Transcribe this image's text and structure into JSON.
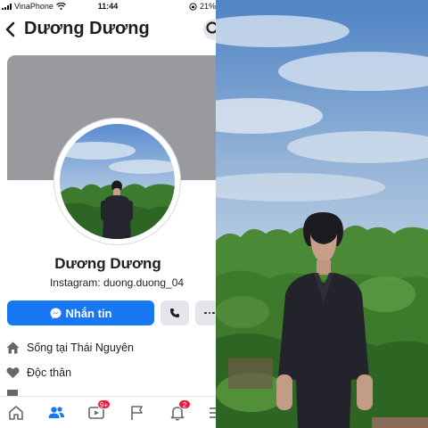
{
  "status_bar": {
    "carrier": "VinaPhone",
    "time": "11:44",
    "battery": "21%"
  },
  "header": {
    "title": "Dương Dương"
  },
  "profile": {
    "name": "Dương Dương",
    "bio": "Instagram: duong.duong_04"
  },
  "actions": {
    "message_label": "Nhắn tin"
  },
  "info": {
    "lives_in": "Sống tại Thái Nguyên",
    "relationship": "Độc thân"
  },
  "nav": {
    "watch_badge": "9+",
    "notifications_badge": "2"
  },
  "colors": {
    "brand_blue": "#1877f2",
    "badge_red": "#e41e3f",
    "cover_gray": "#999a9e"
  },
  "icons": [
    "back-arrow-icon",
    "search-icon",
    "messenger-icon",
    "phone-icon",
    "more-icon",
    "home-icon",
    "heart-icon",
    "friends-icon",
    "watch-icon",
    "flag-icon",
    "bell-icon",
    "menu-icon"
  ]
}
